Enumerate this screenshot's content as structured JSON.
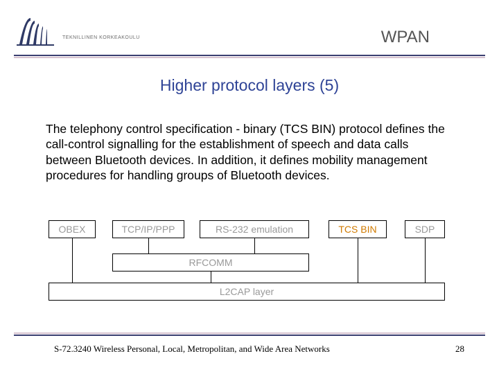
{
  "header": {
    "institution": "TEKNILLINEN KORKEAKOULU",
    "topic": "WPAN"
  },
  "title": "Higher protocol layers (5)",
  "body": "The telephony control specification - binary (TCS BIN) protocol defines the call-control signalling for the establishment of speech and data calls between Bluetooth devices. In addition, it defines mobility management procedures for handling groups of Bluetooth devices.",
  "diagram": {
    "row_top": {
      "obex": "OBEX",
      "tcpip": "TCP/IP/PPP",
      "rs232": "RS-232 emulation",
      "tcsbin": "TCS BIN",
      "sdp": "SDP"
    },
    "row_mid": {
      "rfcomm": "RFCOMM"
    },
    "row_bot": {
      "l2cap": "L2CAP layer"
    }
  },
  "footer": {
    "course": "S-72.3240 Wireless Personal, Local, Metropolitan, and Wide Area Networks",
    "page": "28"
  }
}
